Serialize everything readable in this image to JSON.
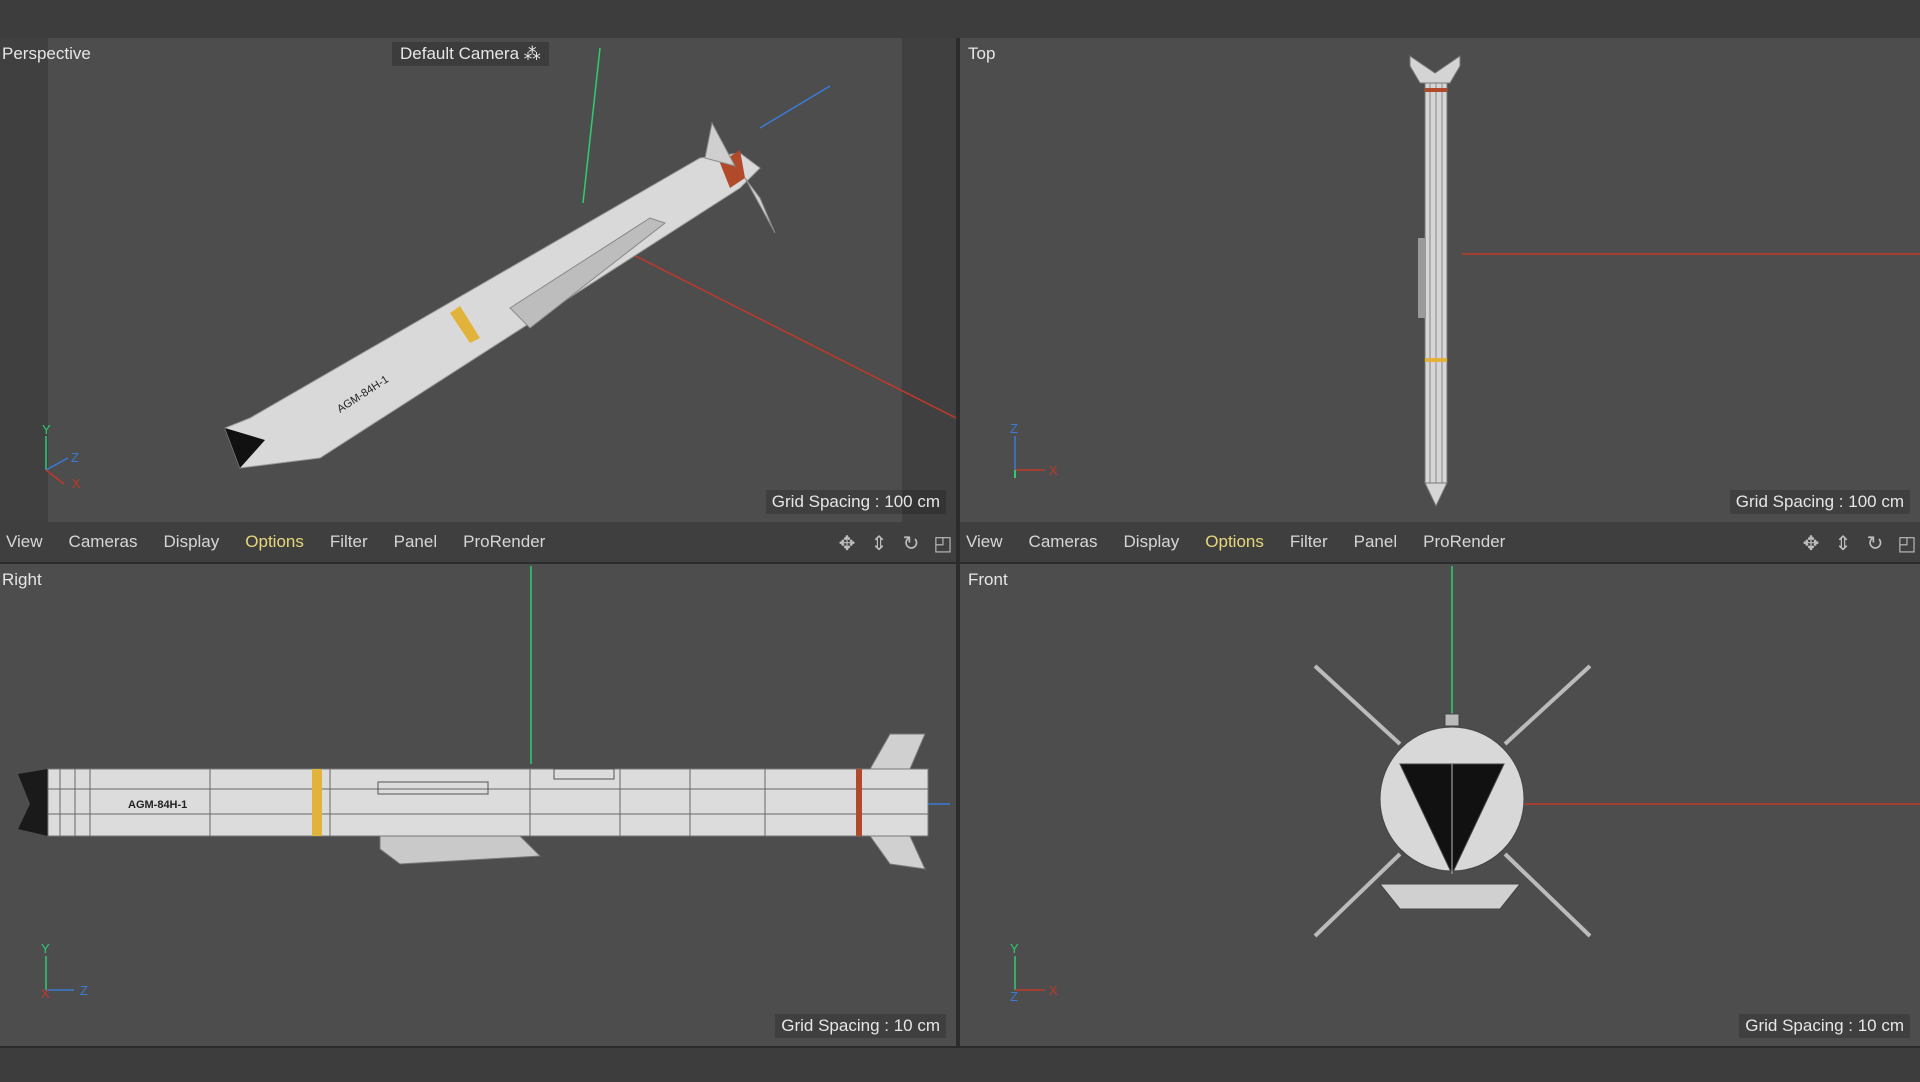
{
  "viewports": {
    "perspective": {
      "label": "Perspective",
      "camera": "Default Camera",
      "grid_spacing": "Grid Spacing : 100 cm"
    },
    "top": {
      "label": "Top",
      "grid_spacing": "Grid Spacing : 100 cm"
    },
    "right": {
      "label": "Right",
      "grid_spacing": "Grid Spacing : 10 cm"
    },
    "front": {
      "label": "Front",
      "grid_spacing": "Grid Spacing : 10 cm"
    }
  },
  "menu": [
    "View",
    "Cameras",
    "Display",
    "Options",
    "Filter",
    "Panel",
    "ProRender"
  ],
  "menu_highlighted": "Options",
  "axes": {
    "x": "X",
    "y": "Y",
    "z": "Z"
  },
  "missile_marking": "AGM-84H-1",
  "icons": [
    "move-view-icon",
    "zoom-view-icon",
    "rotate-view-icon",
    "maximize-view-icon"
  ],
  "colors": {
    "viewport_bg": "#4d4d4d",
    "menu_highlight": "#e8d77a",
    "x_axis": "#c0392b",
    "y_axis": "#2ecc71",
    "z_axis": "#3a7bd5"
  }
}
